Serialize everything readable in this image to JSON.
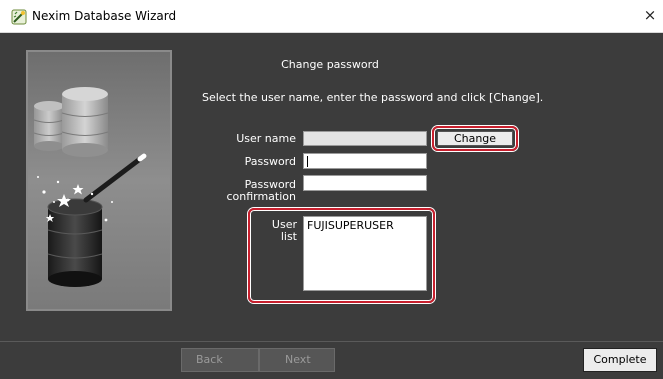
{
  "window": {
    "title": "Nexim Database Wizard",
    "close_glyph": "×",
    "app_icon": "nexim-wizard-icon"
  },
  "main": {
    "heading": "Change password",
    "instruction": "Select the user name, enter the password and click [Change].",
    "user_name_label": "User name",
    "user_name_value": "",
    "password_label": "Password",
    "password_value": "",
    "password_confirmation_label_line1": "Password",
    "password_confirmation_label_line2": "confirmation",
    "password_confirmation_value": "",
    "change_label": "Change",
    "user_list_label": "User list",
    "user_list_items": [
      "FUJISUPERUSER"
    ]
  },
  "footer": {
    "back_label": "Back",
    "next_label": "Next",
    "complete_label": "Complete"
  },
  "colors": {
    "background": "#3c3c3c",
    "highlight": "#c8202e"
  }
}
